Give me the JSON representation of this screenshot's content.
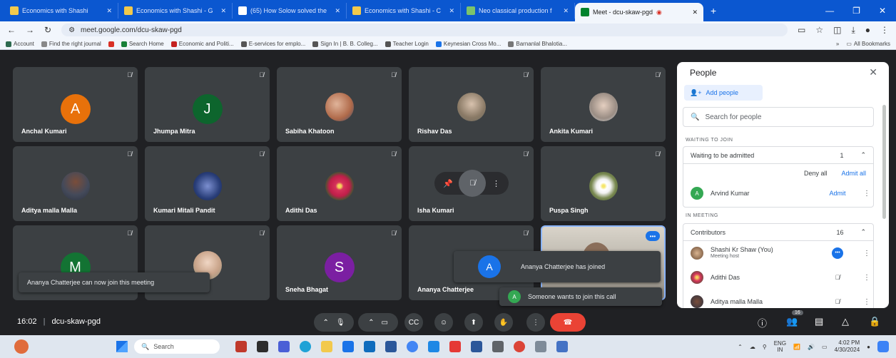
{
  "browser": {
    "tabs": [
      {
        "label": "Economics with Shashi",
        "active": false
      },
      {
        "label": "Economics with Shashi - G",
        "active": false
      },
      {
        "label": "(65) How Solow solved the",
        "active": false
      },
      {
        "label": "Economics with Shashi - C",
        "active": false
      },
      {
        "label": "Neo classical production f",
        "active": false
      },
      {
        "label": "Meet - dcu-skaw-pgd",
        "active": true
      }
    ],
    "url": "meet.google.com/dcu-skaw-pgd",
    "bookmarks": [
      "Account",
      "Find the right journal",
      "Search Home",
      "Economic and Politi...",
      "E-services for emplo...",
      "Sign In | B. B. Colleg...",
      "Teacher Login",
      "Keynesian Cross Mo...",
      "Barnanlal Bhalotia..."
    ],
    "all_bookmarks": "All Bookmarks"
  },
  "participants": [
    {
      "name": "Anchal Kumari",
      "kind": "letter",
      "letter": "A",
      "color": "#e8710a"
    },
    {
      "name": "Jhumpa Mitra",
      "kind": "letter",
      "letter": "J",
      "color": "#0d652d"
    },
    {
      "name": "Sabiha Khatoon",
      "kind": "photo",
      "color": "#b06a4a"
    },
    {
      "name": "Rishav Das",
      "kind": "photo",
      "color": "#8a7a66"
    },
    {
      "name": "Ankita Kumari",
      "kind": "photo",
      "color": "#9a8d84"
    },
    {
      "name": "Aditya malla Malla",
      "kind": "photo",
      "color": "#444a5a"
    },
    {
      "name": "Kumari Mitali Pandit",
      "kind": "photo",
      "color": "#2a3f7a"
    },
    {
      "name": "Adithi Das",
      "kind": "photo",
      "color": "#d5325a"
    },
    {
      "name": "Isha Kumari",
      "kind": "pinned",
      "color": "#5f6368"
    },
    {
      "name": "Puspa Singh",
      "kind": "photo",
      "color": "#7a8a52"
    },
    {
      "name": "",
      "kind": "letter",
      "letter": "M",
      "color": "#137333"
    },
    {
      "name": "",
      "kind": "photo",
      "color": "#c9a48a"
    },
    {
      "name": "Sneha Bhagat",
      "kind": "letter",
      "letter": "S",
      "color": "#7b1fa2"
    },
    {
      "name": "Ananya Chatterjee",
      "kind": "none",
      "color": "#3c4043"
    },
    {
      "name": "",
      "kind": "video",
      "color": "#b7b2a8"
    }
  ],
  "toasts": {
    "can_join": "Ananya Chatterjee can now join this meeting",
    "joined_letter": "A",
    "joined": "Ananya Chatterjee has joined",
    "wants_letter": "A",
    "wants": "Someone wants to join this call"
  },
  "people_panel": {
    "title": "People",
    "add_people": "Add people",
    "search_placeholder": "Search for people",
    "waiting_section": "WAITING TO JOIN",
    "waiting_group": "Waiting to be admitted",
    "waiting_count": "1",
    "deny_all": "Deny all",
    "admit_all": "Admit all",
    "waiting_person": {
      "name": "Arvind Kumar",
      "letter": "A",
      "action": "Admit"
    },
    "in_meeting_section": "IN MEETING",
    "contributors_group": "Contributors",
    "contributors_count": "16",
    "members": [
      {
        "name": "Shashi Kr Shaw (You)",
        "sub": "Meeting host"
      },
      {
        "name": "Adithi Das",
        "sub": ""
      },
      {
        "name": "Aditya malla Malla",
        "sub": ""
      }
    ]
  },
  "controls": {
    "time": "16:02",
    "meeting_code": "dcu-skaw-pgd",
    "people_count": "16"
  },
  "taskbar": {
    "search": "Search",
    "lang_top": "ENG",
    "lang_bottom": "IN",
    "time": "4:02 PM",
    "date": "4/30/2024"
  }
}
